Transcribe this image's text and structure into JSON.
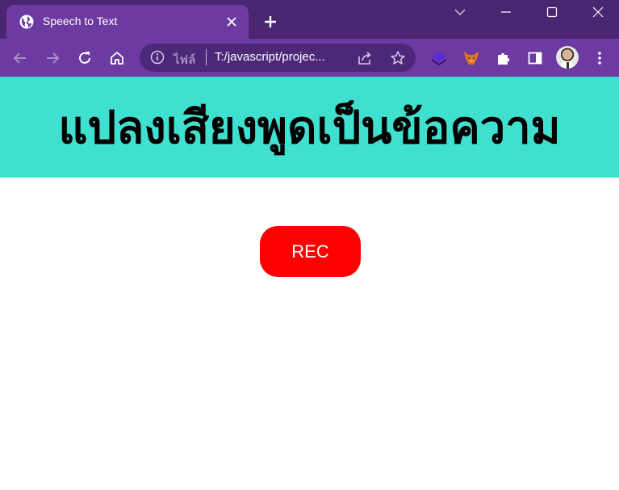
{
  "browser": {
    "tab": {
      "title": "Speech to Text"
    },
    "address_bar": {
      "scheme_label": "ไฟล์",
      "url": "T:/javascript/projec..."
    }
  },
  "page": {
    "heading": "แปลงเสียงพูดเป็นข้อความ",
    "rec_button_label": "REC"
  },
  "colors": {
    "tabstrip": "#4a2570",
    "toolbar": "#6c3aa0",
    "header_bg": "#40e0d0",
    "rec_button_bg": "#ff0000"
  },
  "icons": [
    "globe-icon",
    "close-icon",
    "plus-icon",
    "chevron-down-icon",
    "minimize-icon",
    "maximize-icon",
    "window-close-icon",
    "back-arrow-icon",
    "forward-arrow-icon",
    "reload-icon",
    "home-icon",
    "info-icon",
    "share-icon",
    "star-icon",
    "layers-extension-icon",
    "fox-extension-icon",
    "puzzle-icon",
    "side-panel-icon",
    "kebab-menu-icon"
  ]
}
